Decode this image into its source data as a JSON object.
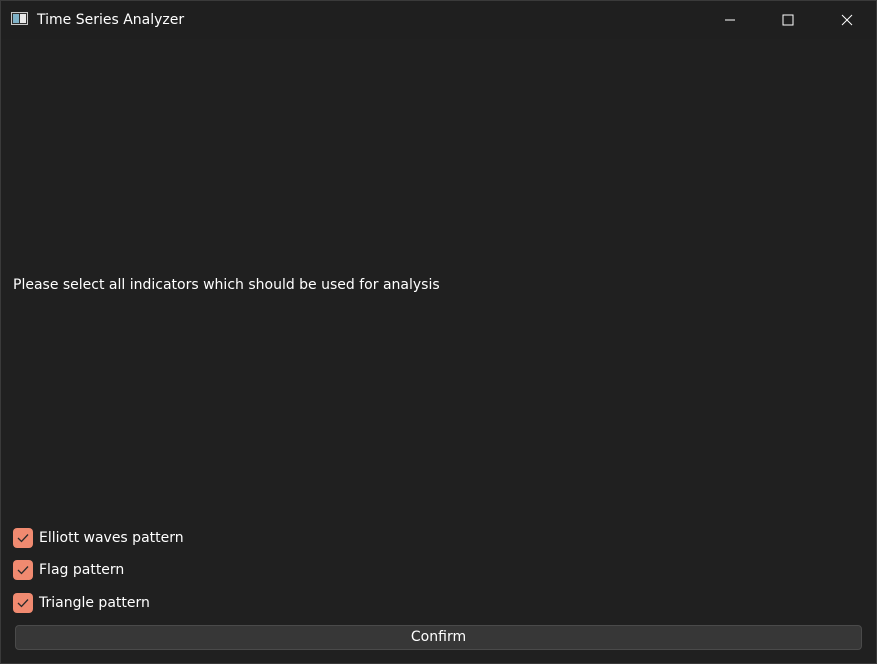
{
  "window": {
    "title": "Time Series Analyzer",
    "controls": {
      "minimize_icon": "minimize-icon",
      "maximize_icon": "maximize-icon",
      "close_icon": "close-icon"
    }
  },
  "main": {
    "prompt": "Please select all indicators which should be used for analysis",
    "indicators": [
      {
        "label": "Elliott waves pattern",
        "checked": true
      },
      {
        "label": "Flag pattern",
        "checked": true
      },
      {
        "label": "Triangle pattern",
        "checked": true
      }
    ],
    "confirm_label": "Confirm"
  },
  "colors": {
    "background": "#202020",
    "accent": "#f08a70",
    "button": "#373737",
    "text": "#ffffff"
  }
}
